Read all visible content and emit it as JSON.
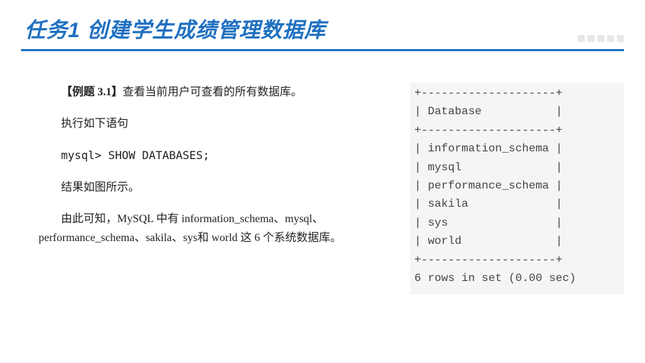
{
  "header": {
    "title": "任务1  创建学生成绩管理数据库"
  },
  "body": {
    "para1_bold": "【例题 3.1】",
    "para1_rest": "查看当前用户可查看的所有数据库。",
    "para2": "执行如下语句",
    "para3": "mysql> SHOW DATABASES;",
    "para4": "结果如图所示。",
    "para5": "由此可知，MySQL 中有 information_schema、mysql、performance_schema、sakila、sys和 world 这 6 个系统数据库。"
  },
  "result": {
    "text": "+--------------------+\n| Database           |\n+--------------------+\n| information_schema |\n| mysql              |\n| performance_schema |\n| sakila             |\n| sys                |\n| world              |\n+--------------------+\n6 rows in set (0.00 sec)"
  }
}
